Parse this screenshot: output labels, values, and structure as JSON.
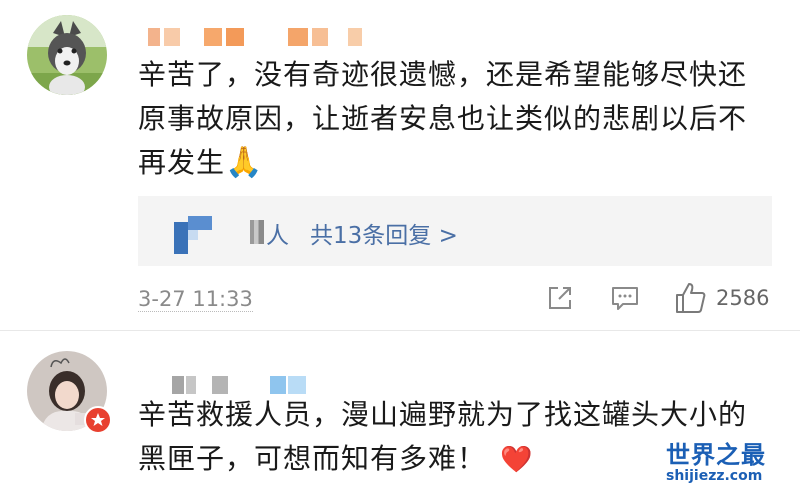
{
  "comments": [
    {
      "text_lines": [
        "辛苦了，没有奇迹很遗憾，还是希望能够尽快还",
        "原事故原因，让逝者安息也让类似的悲剧以后不",
        "再发生"
      ],
      "emoji": "🙏",
      "replies": {
        "fragment": "人",
        "label": "共13条回复 >"
      },
      "time": "3-27 11:33",
      "likes": "2586"
    },
    {
      "text_lines": [
        "辛苦救援人员，漫山遍野就为了找这罐头大小的",
        "黑匣子，可想而知有多难！"
      ],
      "emoji": "❤️"
    }
  ],
  "watermark": {
    "cn": "世界之最",
    "en": "shijiezz.com"
  },
  "colors": {
    "link": "#4a6fa5",
    "watermark": "#1b5fb5",
    "mosaic_orange": "#f6a86c",
    "mosaic_blue": "#8fc5ee"
  },
  "icons": [
    "share-icon",
    "comment-icon",
    "thumbs-up-icon",
    "verified-badge-icon"
  ]
}
